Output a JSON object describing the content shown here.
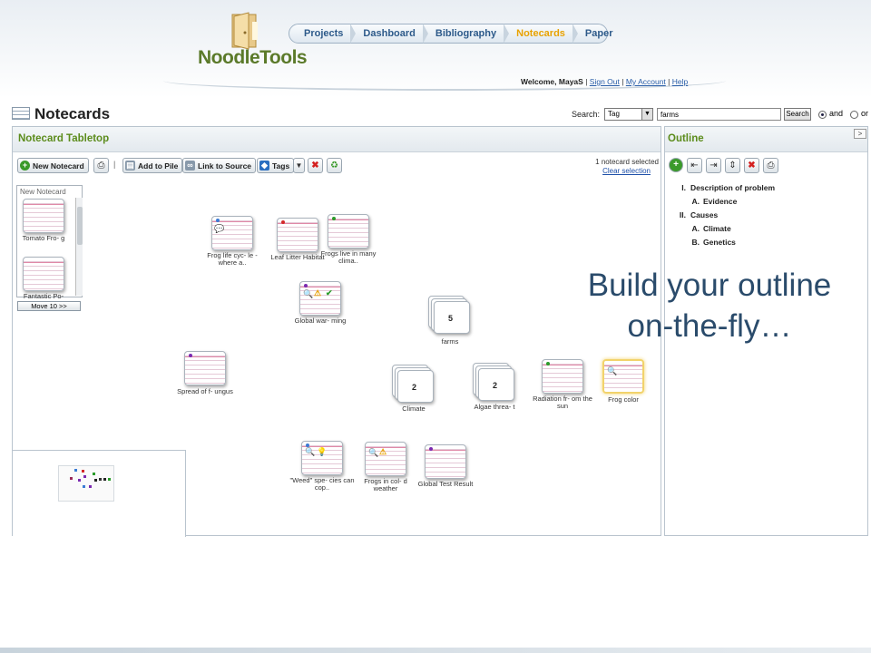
{
  "brand": {
    "name": "NoodleTools",
    "accent": "#5b7a2a"
  },
  "nav": {
    "items": [
      "Projects",
      "Dashboard",
      "Bibliography",
      "Notecards",
      "Paper"
    ],
    "active": "Notecards"
  },
  "user_bar": {
    "welcome": "Welcome, MayaS",
    "sep": "|",
    "sign_out": "Sign Out",
    "my_account": "My Account",
    "help": "Help"
  },
  "page": {
    "title": "Notecards"
  },
  "search": {
    "label": "Search:",
    "type": "Tag",
    "query": "farms",
    "button": "Search",
    "and_label": "and",
    "or_label": "or",
    "mode": "and"
  },
  "tabletop": {
    "title": "Notecard Tabletop",
    "toolbar": {
      "new_notecard": "New Notecard",
      "sep": "|",
      "add_to_pile": "Add to Pile",
      "link_to_source": "Link to Source",
      "tags": "Tags"
    },
    "selection": {
      "count_text": "1 notecard selected",
      "clear": "Clear selection"
    },
    "pile": {
      "label": "New Notecard",
      "cards": [
        "Tomato Fro- g",
        "Fantastic Po-"
      ],
      "move_button": "Move 10 >>"
    },
    "cards": [
      {
        "label": "Frog life cyc- le - where a..",
        "dot": "#3a7bd5"
      },
      {
        "label": "Leaf Litter Habitat",
        "dot": "#d42a2a"
      },
      {
        "label": "Frogs live in many clima..",
        "dot": "#2a9c2a"
      },
      {
        "label": "Global war- ming",
        "dot": "#7b2ab0"
      },
      {
        "label": "Spread of f- ungus",
        "dot": "#7b2ab0"
      },
      {
        "label": "Radiation fr- om the sun",
        "dot": "#2a9c2a"
      },
      {
        "label": "Frog color",
        "dot": ""
      },
      {
        "label": "\"Weed\" spe- cies can cop..",
        "dot": "#3a7bd5"
      },
      {
        "label": "Frogs in col- d weather",
        "dot": ""
      },
      {
        "label": "Global Test Result",
        "dot": "#7b2ab0"
      }
    ],
    "piles": [
      {
        "label": "farms",
        "count": "5"
      },
      {
        "label": "Climate",
        "count": "2"
      },
      {
        "label": "Algae threa- t",
        "count": "2"
      }
    ]
  },
  "outline": {
    "title": "Outline",
    "collapse_icon": ">",
    "items": [
      {
        "num": "I.",
        "text": "Description of problem",
        "level": 1
      },
      {
        "num": "A.",
        "text": "Evidence",
        "level": 2
      },
      {
        "num": "II.",
        "text": "Causes",
        "level": 1
      },
      {
        "num": "A.",
        "text": "Climate",
        "level": 2
      },
      {
        "num": "B.",
        "text": "Genetics",
        "level": 2
      }
    ]
  },
  "promo": {
    "line1": "Build your outline",
    "line2": "on-the-fly…"
  }
}
